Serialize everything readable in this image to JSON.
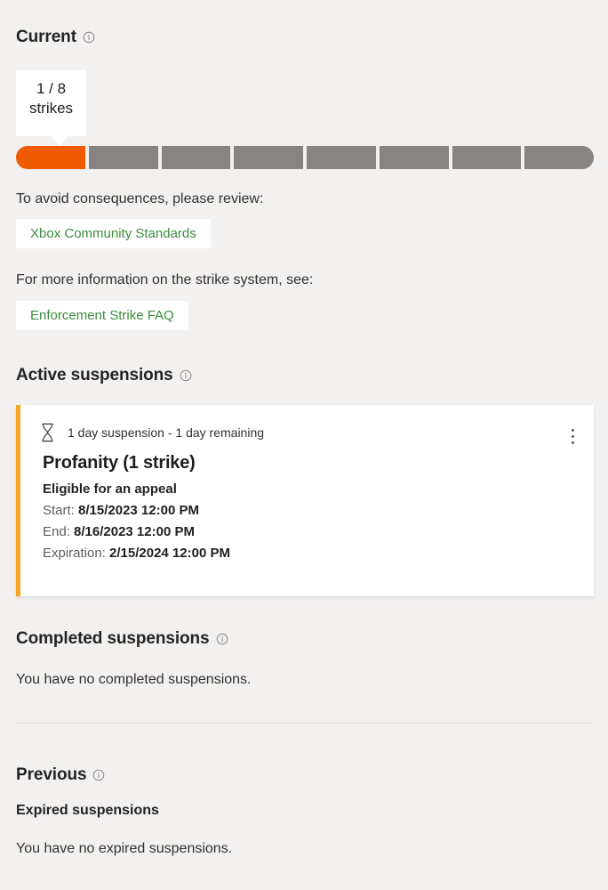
{
  "current": {
    "heading": "Current",
    "info_icon": "info-icon",
    "callout": {
      "count_line": "1 / 8",
      "unit_line": "strikes",
      "strikes_used": 1,
      "strikes_total": 8
    },
    "progress": {
      "filled_color": "#f05a00",
      "empty_color": "#868584",
      "segments": [
        {
          "state": "filled"
        },
        {
          "state": "empty"
        },
        {
          "state": "empty"
        },
        {
          "state": "empty"
        },
        {
          "state": "empty"
        },
        {
          "state": "empty"
        },
        {
          "state": "empty"
        },
        {
          "state": "empty"
        }
      ]
    },
    "standards_prompt": "To avoid consequences, please review:",
    "standards_link": "Xbox Community Standards",
    "faq_prompt": "For more information on the strike system, see:",
    "faq_link": "Enforcement Strike FAQ",
    "link_color": "#3c8c3f"
  },
  "active_suspensions": {
    "heading": "Active suspensions",
    "info_icon": "info-icon",
    "card": {
      "accent_color": "#f5a623",
      "status_icon": "hourglass-icon",
      "status_text": "1 day suspension - 1 day remaining",
      "menu_icon": "kebab-menu-icon",
      "title": "Profanity (1 strike)",
      "appeal_text": "Eligible for an appeal",
      "dates": [
        {
          "label": "Start:",
          "value": "8/15/2023 12:00 PM"
        },
        {
          "label": "End:",
          "value": "8/16/2023 12:00 PM"
        },
        {
          "label": "Expiration:",
          "value": "2/15/2024 12:00 PM"
        }
      ]
    }
  },
  "completed_suspensions": {
    "heading": "Completed suspensions",
    "info_icon": "info-icon",
    "empty_text": "You have no completed suspensions."
  },
  "previous": {
    "heading": "Previous",
    "info_icon": "info-icon",
    "expired_heading": "Expired suspensions",
    "expired_empty_text": "You have no expired suspensions."
  }
}
